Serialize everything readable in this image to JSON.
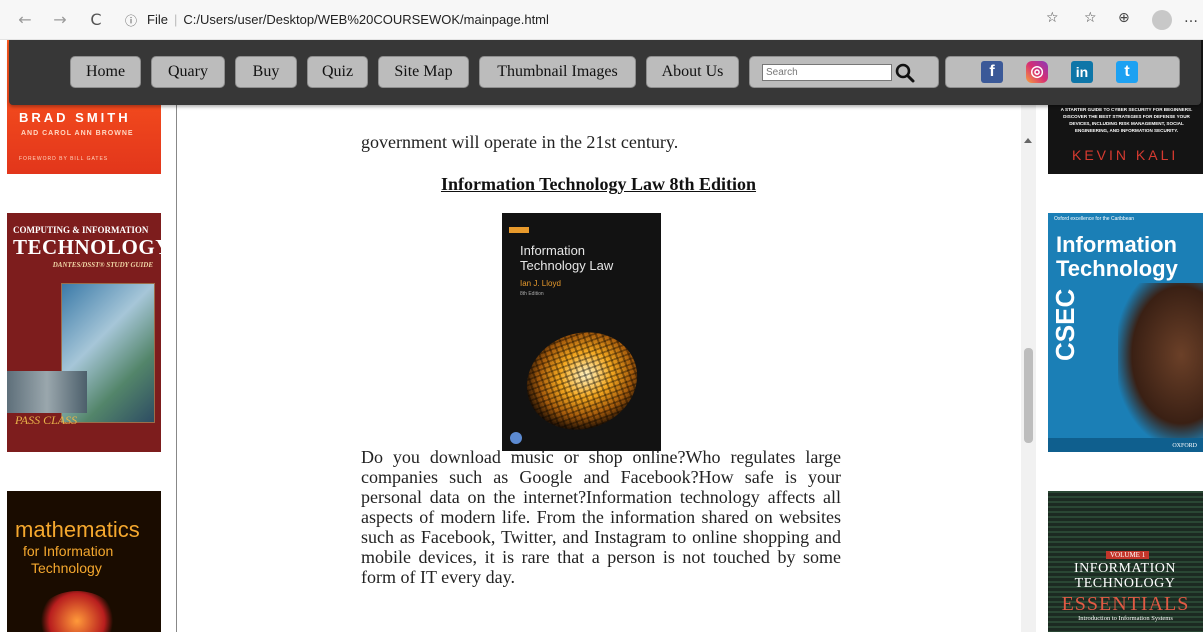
{
  "browser": {
    "back_icon": "←",
    "forward_icon": "→",
    "reload_icon": "C",
    "info_icon": "ⓘ",
    "scheme": "File",
    "url": "C:/Users/user/Desktop/WEB%20COURSEWOK/mainpage.html",
    "right_icons": [
      "☆",
      "☆",
      "⊕",
      "…"
    ]
  },
  "nav": {
    "items": [
      "Home",
      "Quary",
      "Buy",
      "Quiz",
      "Site Map",
      "Thumbnail Images",
      "About Us"
    ],
    "search_placeholder": "Search",
    "social": [
      "f",
      "◎",
      "in",
      "t"
    ]
  },
  "colors": {
    "navbar": "#373737",
    "nav_button": "#bcbcbc",
    "facebook": "#3b5998",
    "instagram": "#c13584",
    "linkedin": "#0e76a8",
    "twitter": "#1da1f2"
  },
  "side_books": {
    "left": [
      {
        "title": "BRAD SMITH",
        "subtitle": "AND CAROL ANN BROWNE",
        "note": "FOREWORD BY BILL GATES"
      },
      {
        "title_top": "COMPUTING & INFORMATION",
        "title": "TECHNOLOGY",
        "subtitle": "DANTES/DSST® STUDY GUIDE",
        "badge": "PASS CLASS"
      },
      {
        "title": "mathematics",
        "subtitle_a": "for Information",
        "subtitle_b": "Technology"
      }
    ],
    "right": [
      {
        "blurb": "A STARTER GUIDE TO CYBER SECURITY FOR BEGINNERS. DISCOVER THE BEST STRATEGIES FOR DEFENSE YOUR DEVICES, INCLUDING RISK MANAGEMENT, SOCIAL ENGINEERING, AND INFORMATION SECURITY.",
        "author": "KEVIN KALI"
      },
      {
        "top": "Oxford excellence for the Caribbean",
        "title": "Information Technology",
        "vertical": "CSEC",
        "publisher": "OXFORD"
      },
      {
        "badge": "VOLUME 1",
        "title": "INFORMATION TECHNOLOGY",
        "subtitle": "ESSENTIALS",
        "note": "Introduction to Information Systems"
      }
    ]
  },
  "content": {
    "para1": "government will operate in the 21st century.",
    "heading": "Information Technology Law 8th Edition",
    "cover": {
      "title": "Information Technology Law",
      "author": "Ian J. Lloyd",
      "edition": "8th Edition"
    },
    "para2": "Do you download music or shop online?Who regulates large companies such as Google and Facebook?How safe is your personal data on the internet?Information technology affects all aspects of modern life. From the information shared on websites such as Facebook, Twitter, and Instagram to online shopping and mobile devices, it is rare that a person is not touched by some form of IT every day."
  }
}
